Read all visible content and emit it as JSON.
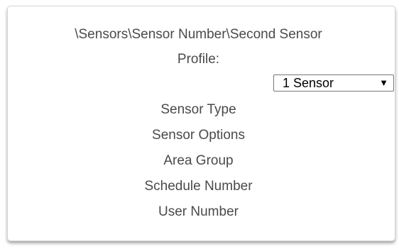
{
  "panel": {
    "path": "\\Sensors\\Sensor Number\\Second Sensor",
    "profile_label": "Profile:",
    "profile_select": {
      "value": "1 Sensor",
      "arrow_icon": "caret-down-icon"
    },
    "fields": [
      "Sensor Type",
      "Sensor Options",
      "Area Group",
      "Schedule Number",
      "User Number"
    ]
  }
}
